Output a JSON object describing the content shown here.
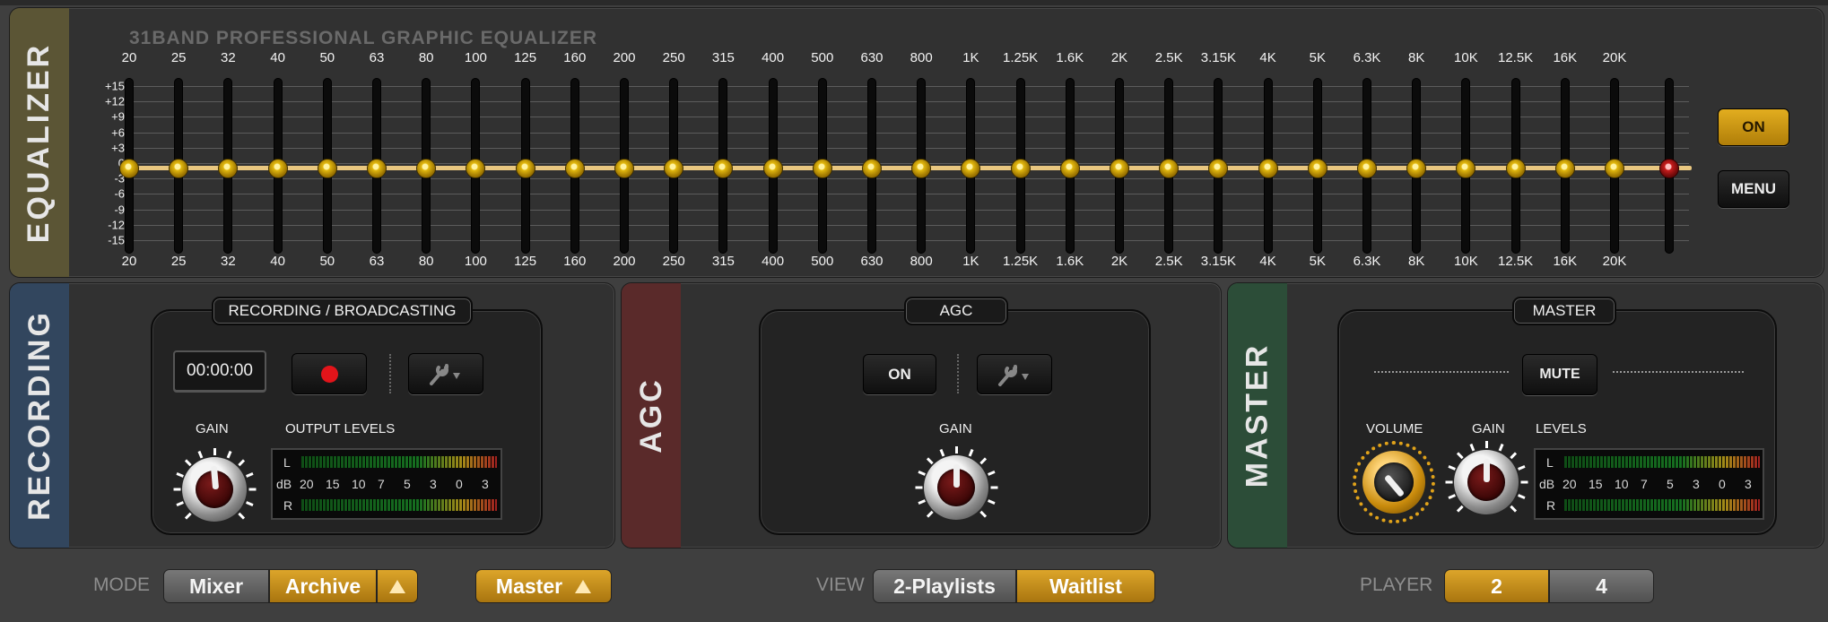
{
  "equalizer": {
    "side_label": "EQUALIZER",
    "title": "31BAND PROFESSIONAL GRAPHIC EQUALIZER",
    "bands": [
      "20",
      "25",
      "32",
      "40",
      "50",
      "63",
      "80",
      "100",
      "125",
      "160",
      "200",
      "250",
      "315",
      "400",
      "500",
      "630",
      "800",
      "1K",
      "1.25K",
      "1.6K",
      "2K",
      "2.5K",
      "3.15K",
      "4K",
      "5K",
      "6.3K",
      "8K",
      "10K",
      "12.5K",
      "16K",
      "20K"
    ],
    "db_scale": [
      "+15",
      "+12",
      "+9",
      "+6",
      "+3",
      "0",
      "-3",
      "-6",
      "-9",
      "-12",
      "-15"
    ],
    "band_values": [
      0,
      0,
      0,
      0,
      0,
      0,
      0,
      0,
      0,
      0,
      0,
      0,
      0,
      0,
      0,
      0,
      0,
      0,
      0,
      0,
      0,
      0,
      0,
      0,
      0,
      0,
      0,
      0,
      0,
      0,
      0
    ],
    "preamp_value": 0,
    "on_label": "ON",
    "menu_label": "MENU",
    "curve_color": "#e9c780",
    "knob_color": "#e3b90f",
    "preamp_color": "#c81c1c"
  },
  "recording": {
    "side_label": "RECORDING",
    "side_color": "#32465e",
    "box_title": "RECORDING / BROADCASTING",
    "time": "00:00:00",
    "record_icon": "record-icon",
    "settings_icon": "wrench-icon",
    "gain_label": "GAIN",
    "levels_label": "OUTPUT LEVELS",
    "meter_l": "L",
    "meter_r": "R",
    "meter_db": "dB",
    "meter_scale": [
      "20",
      "15",
      "10",
      "7",
      "5",
      "3",
      "0",
      "3"
    ]
  },
  "agc": {
    "side_label": "AGC",
    "side_color": "#5a2a2a",
    "box_title": "AGC",
    "on_label": "ON",
    "settings_icon": "wrench-icon",
    "gain_label": "GAIN"
  },
  "master": {
    "side_label": "MASTER",
    "side_color": "#2c4d38",
    "box_title": "MASTER",
    "mute_label": "MUTE",
    "volume_label": "VOLUME",
    "gain_label": "GAIN",
    "levels_label": "LEVELS",
    "meter_l": "L",
    "meter_r": "R",
    "meter_db": "dB",
    "meter_scale": [
      "20",
      "15",
      "10",
      "7",
      "5",
      "3",
      "0",
      "3"
    ],
    "volume_ring_color": "#e0a21a"
  },
  "bottom": {
    "mode_label": "MODE",
    "mode_options": [
      "Mixer",
      "Archive"
    ],
    "mode_selected": "Archive",
    "master_label": "Master",
    "view_label": "VIEW",
    "view_options": [
      "2-Playlists",
      "Waitlist"
    ],
    "view_selected": "Waitlist",
    "player_label": "PLAYER",
    "player_options": [
      "2",
      "4"
    ],
    "player_selected": "2",
    "accent": "#dca52a"
  }
}
